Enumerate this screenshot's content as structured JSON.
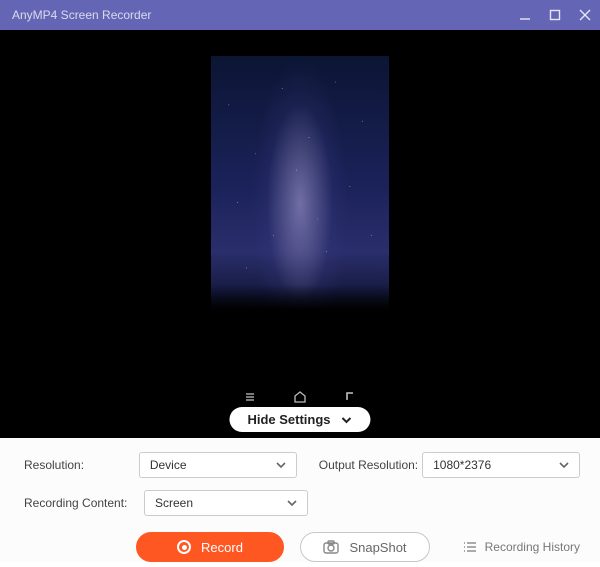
{
  "titlebar": {
    "title": "AnyMP4 Screen Recorder"
  },
  "preview": {
    "hide_settings_label": "Hide Settings"
  },
  "settings": {
    "resolution_label": "Resolution:",
    "resolution_value": "Device",
    "recording_content_label": "Recording Content:",
    "recording_content_value": "Screen",
    "output_resolution_label": "Output Resolution:",
    "output_resolution_value": "1080*2376"
  },
  "actions": {
    "record_label": "Record",
    "snapshot_label": "SnapShot",
    "history_label": "Recording History"
  }
}
